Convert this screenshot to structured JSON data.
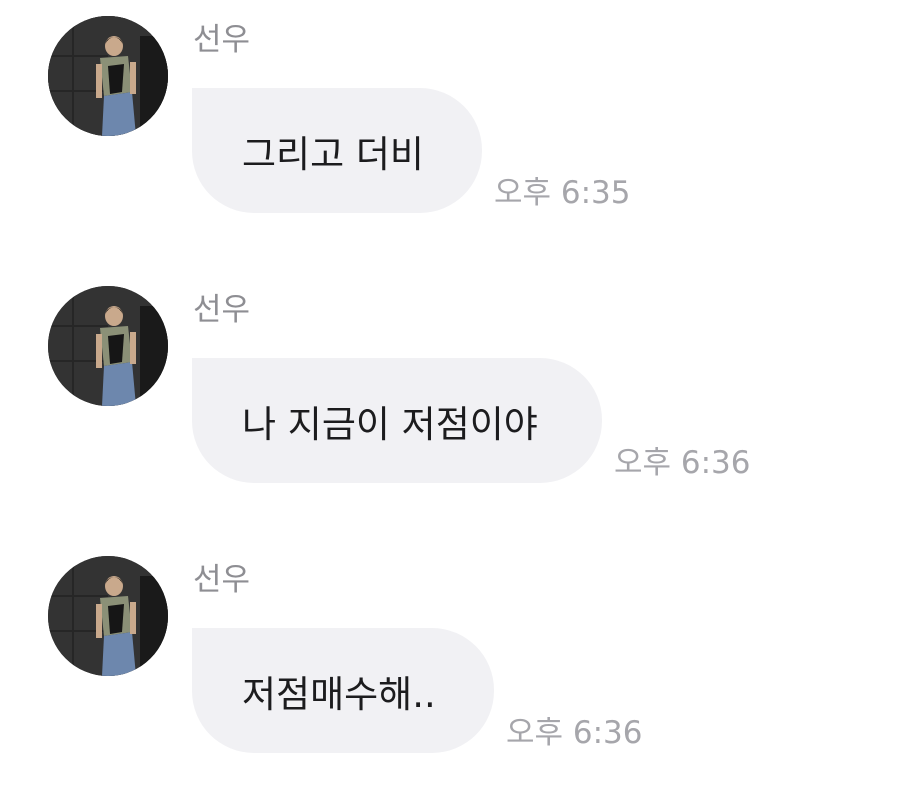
{
  "messages": [
    {
      "sender": "선우",
      "text": "그리고 더비",
      "time": "오후 6:35"
    },
    {
      "sender": "선우",
      "text": "나 지금이 저점이야",
      "time": "오후 6:36"
    },
    {
      "sender": "선우",
      "text": "저점매수해..",
      "time": "오후 6:36"
    }
  ],
  "colors": {
    "bubble": "#f1f1f4",
    "sender_text": "#8e8e93",
    "time_text": "#a6a6ab",
    "message_text": "#1c1c1e"
  }
}
